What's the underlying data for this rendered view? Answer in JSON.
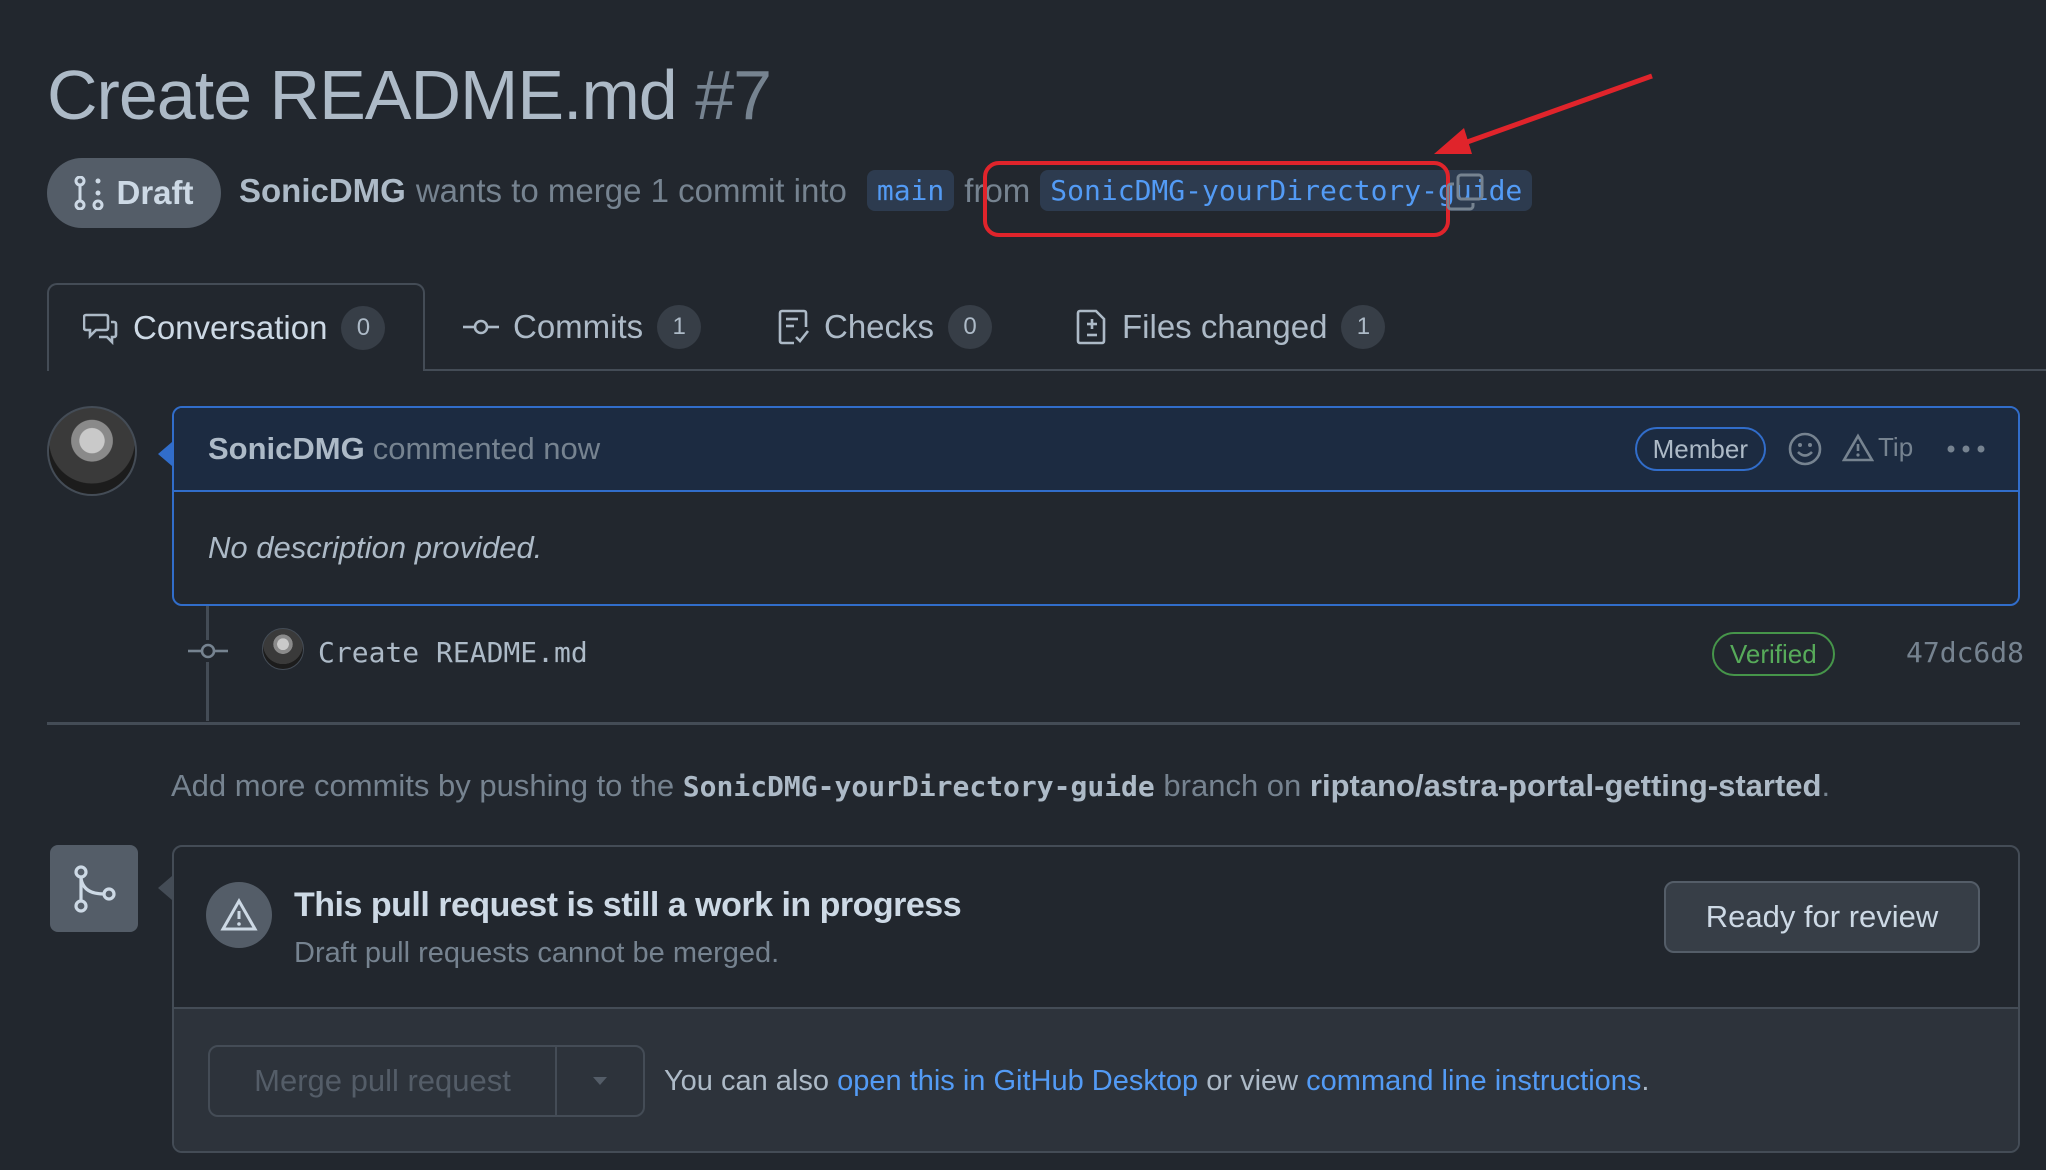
{
  "pr": {
    "title": "Create README.md",
    "number": "#7",
    "state": "Draft",
    "author": "SonicDMG",
    "merge_text": "wants to merge 1 commit into",
    "base_branch": "main",
    "from_text": "from",
    "head_branch": "SonicDMG-yourDirectory-guide"
  },
  "tabs": [
    {
      "label": "Conversation",
      "count": "0"
    },
    {
      "label": "Commits",
      "count": "1"
    },
    {
      "label": "Checks",
      "count": "0"
    },
    {
      "label": "Files changed",
      "count": "1"
    }
  ],
  "comment": {
    "author": "SonicDMG",
    "time": "commented now",
    "role_badge": "Member",
    "tip_label": "Tip",
    "body": "No description provided."
  },
  "commit": {
    "message": "Create README.md",
    "verified_label": "Verified",
    "sha": "47dc6d8"
  },
  "push_message": {
    "prefix": "Add more commits by pushing to the",
    "branch": "SonicDMG-yourDirectory-guide",
    "middle": "branch on",
    "repo": "riptano/astra-portal-getting-started",
    "suffix": "."
  },
  "merge": {
    "status_title": "This pull request is still a work in progress",
    "status_sub": "Draft pull requests cannot be merged.",
    "ready_label": "Ready for review",
    "merge_label": "Merge pull request",
    "note_prefix": "You can also",
    "link_desktop": "open this in GitHub Desktop",
    "note_middle": "or view",
    "link_cli": "command line instructions",
    "note_suffix": "."
  },
  "colors": {
    "background": "#22272e",
    "accent_blue": "#539bf5",
    "highlight_red": "#e0242b",
    "verified_green": "#57ab5a"
  }
}
